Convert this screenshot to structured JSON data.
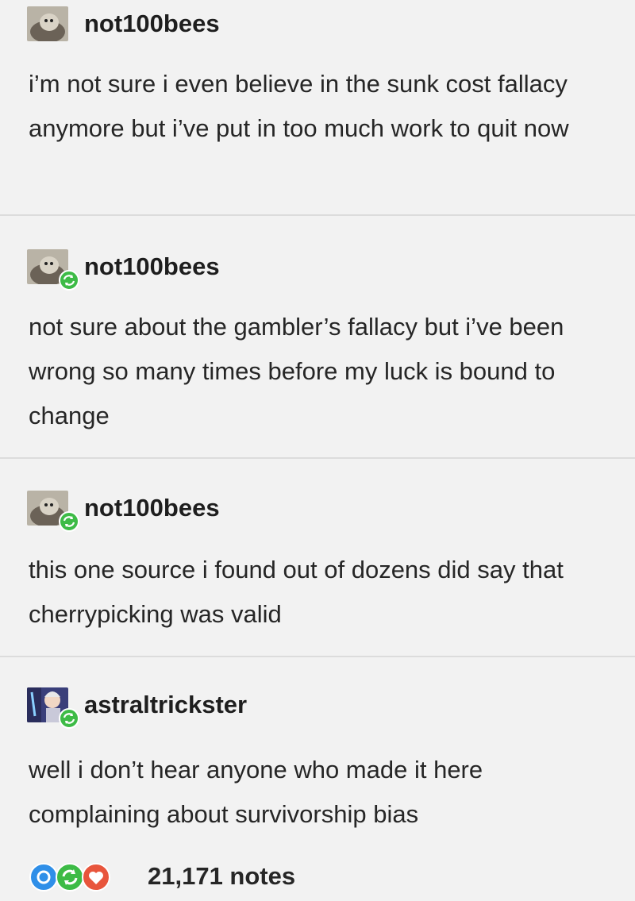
{
  "posts": [
    {
      "username": "not100bees",
      "avatar": "seal-avatar",
      "reblog": false,
      "text": "i’m not sure i even believe in the sunk cost fallacy anymore but i’ve put in too much work to quit now"
    },
    {
      "username": "not100bees",
      "avatar": "seal-avatar",
      "reblog": true,
      "text": "not sure about the gambler’s fallacy but i’ve been wrong so many times before my luck is bound to change"
    },
    {
      "username": "not100bees",
      "avatar": "seal-avatar",
      "reblog": true,
      "text": "this one source i found out of dozens did say that cherrypicking was valid"
    },
    {
      "username": "astraltrickster",
      "avatar": "character-avatar",
      "reblog": true,
      "text": "well i don’t hear anyone who made it here complaining about survivorship bias"
    }
  ],
  "footer": {
    "notes_label": "21,171 notes",
    "note_icons": [
      "comment-icon",
      "reblog-icon",
      "heart-icon"
    ]
  },
  "colors": {
    "background": "#f2f2f2",
    "separator": "#dcdcdc",
    "reblog_green": "#3dbb46",
    "comment_blue": "#2f8fe8",
    "heart_red": "#e8553c"
  }
}
